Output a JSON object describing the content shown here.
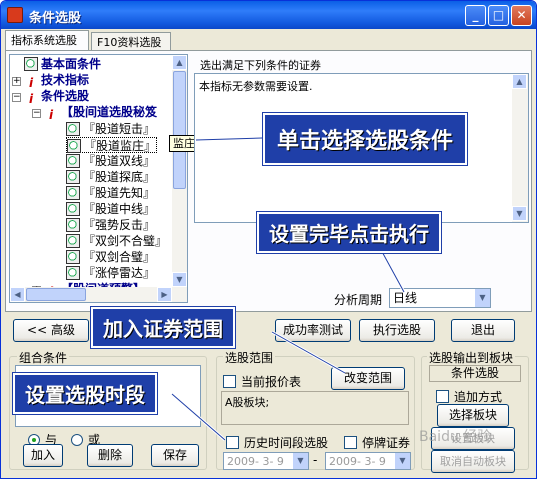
{
  "window": {
    "title": "条件选股"
  },
  "tabs": [
    {
      "label": "指标系统选股"
    },
    {
      "label": "F10资料选股"
    }
  ],
  "tree": {
    "items": [
      {
        "label": "基本面条件"
      },
      {
        "label": "技术指标"
      },
      {
        "label": "条件选股"
      },
      {
        "label": "【股间道选股秘笈"
      },
      {
        "label": "『股道短击』"
      },
      {
        "label": "『股道监庄』"
      },
      {
        "label": "『股道双线』"
      },
      {
        "label": "『股道探底』"
      },
      {
        "label": "『股道先知』"
      },
      {
        "label": "『股道中线』"
      },
      {
        "label": "『强势反击』"
      },
      {
        "label": "『双剑不合璧』"
      },
      {
        "label": "『双剑合璧』"
      },
      {
        "label": "『涨停雷达』"
      },
      {
        "label": "【股间道预警】"
      }
    ],
    "tooltip": "监庄极品"
  },
  "description": {
    "label": "选出满足下列条件的证券",
    "text": "本指标无参数需要设置."
  },
  "period": {
    "label": "分析周期",
    "value": "日线"
  },
  "buttons": {
    "advanced": "<< 高级",
    "success_test": "成功率测试",
    "execute": "执行选股",
    "exit": "退出"
  },
  "combo_group": {
    "title": "组合条件",
    "radio_and": "与",
    "radio_or": "或",
    "add": "加入",
    "delete": "删除",
    "save": "保存"
  },
  "range_group": {
    "title": "选股范围",
    "current_quote": "当前报价表",
    "change_range": "改变范围",
    "range_text": "A股板块;",
    "history": "历史时间段选股",
    "suspended": "停牌证券",
    "date_from": "2009- 3- 9",
    "date_sep": "-",
    "date_to": "2009- 3- 9"
  },
  "output_group": {
    "title": "选股输出到板块",
    "name": "条件选股",
    "append": "追加方式",
    "select_block": "选择板块",
    "set_block": "设置板块",
    "cancel_block": "取消自动板块"
  },
  "annotations": {
    "click_select": "单击选择选股条件",
    "click_execute": "设置完毕点击执行",
    "add_range": "加入证券范围",
    "set_period": "设置选股时段"
  },
  "watermark": "Baidu 经验",
  "colors": {
    "annotation_bg": "#1f3fa8",
    "arrow": "#ffffff"
  }
}
